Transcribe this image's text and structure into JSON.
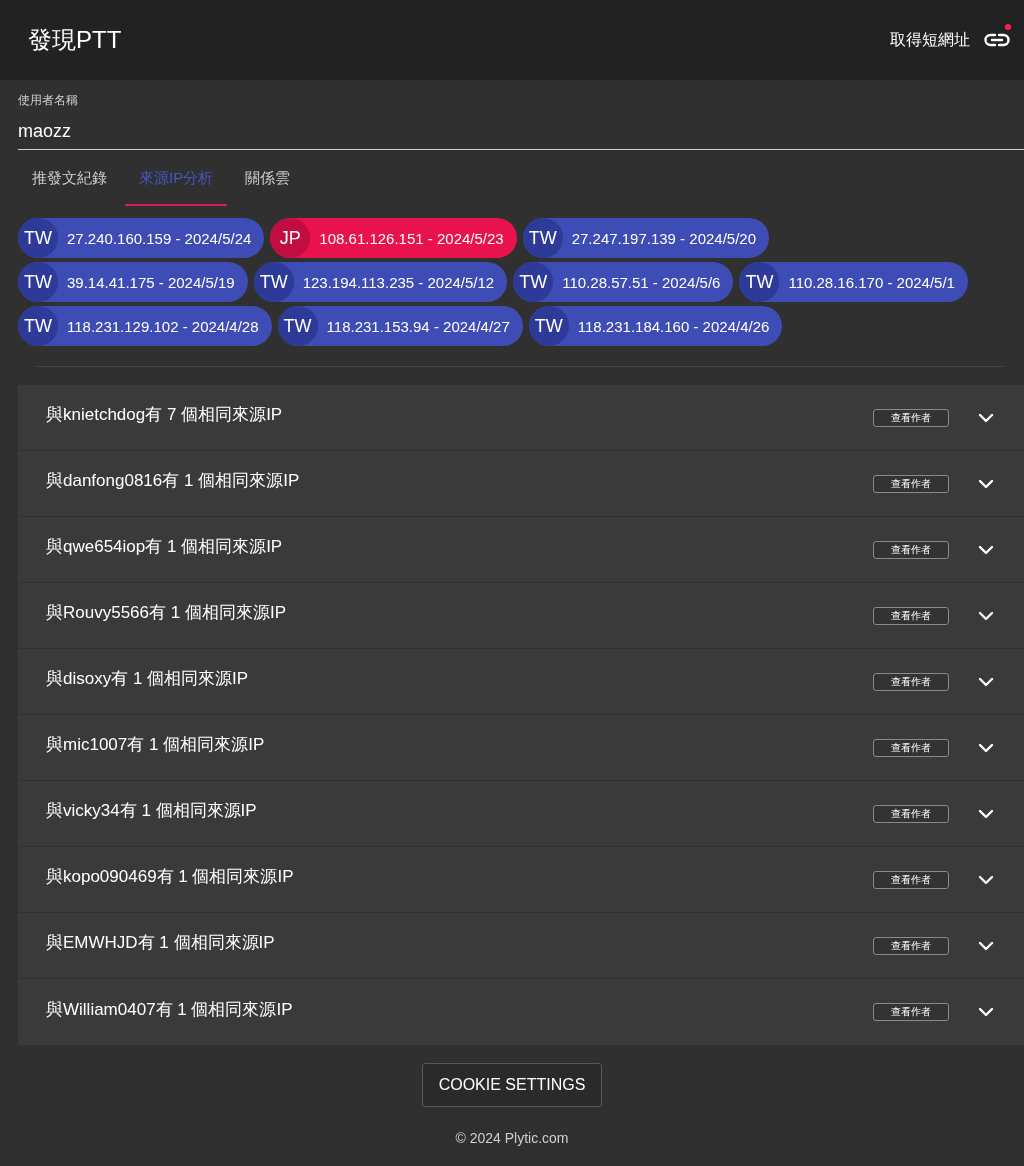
{
  "header": {
    "title": "發現PTT",
    "share_link": {
      "label": "取得短網址",
      "has_notification": true
    }
  },
  "username_field": {
    "label": "使用者名稱",
    "value": "maozz"
  },
  "tabs": [
    {
      "label": "推發文紀錄",
      "selected": false
    },
    {
      "label": "來源IP分析",
      "selected": true
    },
    {
      "label": "關係雲",
      "selected": false
    }
  ],
  "ip_chips": [
    {
      "country": "TW",
      "text": "27.240.160.159 - 2024/5/24",
      "selected": false
    },
    {
      "country": "JP",
      "text": "108.61.126.151 - 2024/5/23",
      "selected": true
    },
    {
      "country": "TW",
      "text": "27.247.197.139 - 2024/5/20",
      "selected": false
    },
    {
      "country": "TW",
      "text": "39.14.41.175 - 2024/5/19",
      "selected": false
    },
    {
      "country": "TW",
      "text": "123.194.113.235 - 2024/5/12",
      "selected": false
    },
    {
      "country": "TW",
      "text": "110.28.57.51 - 2024/5/6",
      "selected": false
    },
    {
      "country": "TW",
      "text": "110.28.16.170 - 2024/5/1",
      "selected": false
    },
    {
      "country": "TW",
      "text": "118.231.129.102 - 2024/4/28",
      "selected": false
    },
    {
      "country": "TW",
      "text": "118.231.153.94 - 2024/4/27",
      "selected": false
    },
    {
      "country": "TW",
      "text": "118.231.184.160 - 2024/4/26",
      "selected": false
    }
  ],
  "matches": [
    {
      "text": "與knietchdog有 7 個相同來源IP",
      "button": "查看作者",
      "expanded": false
    },
    {
      "text": "與danfong0816有 1 個相同來源IP",
      "button": "查看作者",
      "expanded": false
    },
    {
      "text": "與qwe654iop有 1 個相同來源IP",
      "button": "查看作者",
      "expanded": false
    },
    {
      "text": "與Rouvy5566有 1 個相同來源IP",
      "button": "查看作者",
      "expanded": false
    },
    {
      "text": "與disoxy有 1 個相同來源IP",
      "button": "查看作者",
      "expanded": false
    },
    {
      "text": "與mic1007有 1 個相同來源IP",
      "button": "查看作者",
      "expanded": false
    },
    {
      "text": "與vicky34有 1 個相同來源IP",
      "button": "查看作者",
      "expanded": false
    },
    {
      "text": "與kopo090469有 1 個相同來源IP",
      "button": "查看作者",
      "expanded": false
    },
    {
      "text": "與EMWHJD有 1 個相同來源IP",
      "button": "查看作者",
      "expanded": false
    },
    {
      "text": "與William0407有 1 個相同來源IP",
      "button": "查看作者",
      "expanded": false
    }
  ],
  "footer": {
    "cookie_button": "COOKIE SETTINGS",
    "copyright": "© 2024 Plytic.com"
  }
}
